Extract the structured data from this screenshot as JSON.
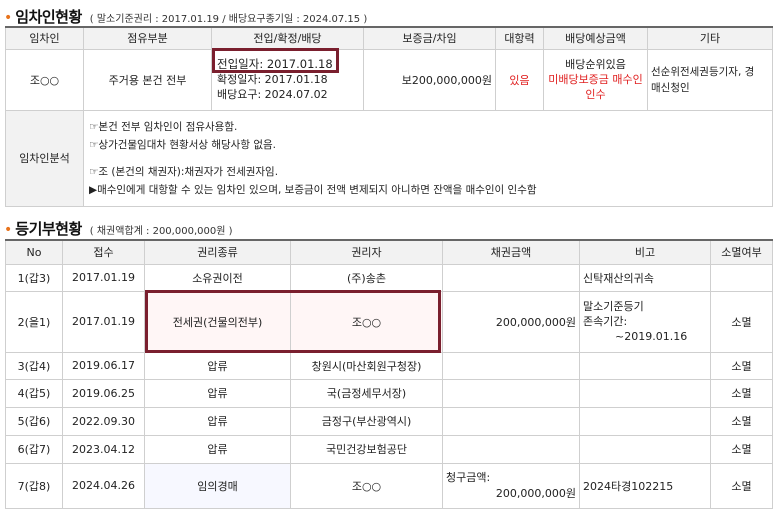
{
  "section1": {
    "title": "임차인현황",
    "subtitle": "( 말소기준권리 : 2017.01.19 / 배당요구종기일 : 2024.07.15 )",
    "headers": [
      "임차인",
      "점유부분",
      "전입/확정/배당",
      "보증금/차임",
      "대항력",
      "배당예상금액",
      "기타"
    ],
    "tenant": {
      "name": "조○○",
      "occupancy": "주거용 본건 전부",
      "move_in": "전입일자: 2017.01.18",
      "fixed_date": "확정일자: 2017.01.18",
      "dividend_date": "배당요구: 2024.07.02",
      "deposit": "보200,000,000원",
      "opposing_power": "있음",
      "dividend_line1": "배당순위있음",
      "dividend_line2": "미배당보증금 매수인",
      "dividend_line3": "인수",
      "etc_line1": "선순위전세권등기자, 경",
      "etc_line2": "매신청인"
    },
    "analysis": {
      "label": "임차인분석",
      "lines": [
        "☞본건 전부 임차인이 점유사용함.",
        "☞상가건물임대차 현황서상 해당사항 없음.",
        "",
        "☞조      (본건의 채권자):채권자가 전세권자임.",
        "▶매수인에게 대항할 수 있는 임차인 있으며, 보증금이 전액 변제되지 아니하면 잔액을 매수인이 인수함"
      ]
    }
  },
  "section2": {
    "title": "등기부현황",
    "subtitle": "( 채권액합계 : 200,000,000원 )",
    "headers": [
      "No",
      "접수",
      "권리종류",
      "권리자",
      "채권금액",
      "비고",
      "소멸여부"
    ],
    "rows": [
      {
        "no": "1(갑3)",
        "date": "2017.01.19",
        "type": "소유권이전",
        "holder": "(주)송촌",
        "amount": "",
        "note1": "신탁재산의귀속",
        "note2": "",
        "note3": "",
        "status": ""
      },
      {
        "no": "2(을1)",
        "date": "2017.01.19",
        "type": "전세권(건물의전부)",
        "holder": "조○○",
        "amount": "200,000,000원",
        "note1": "말소기준등기",
        "note2": "존속기간:",
        "note3": "~2019.01.16",
        "status": "소멸"
      },
      {
        "no": "3(갑4)",
        "date": "2019.06.17",
        "type": "압류",
        "holder": "창원시(마산회원구청장)",
        "amount": "",
        "note1": "",
        "note2": "",
        "note3": "",
        "status": "소멸"
      },
      {
        "no": "4(갑5)",
        "date": "2019.06.25",
        "type": "압류",
        "holder": "국(금정세무서장)",
        "amount": "",
        "note1": "",
        "note2": "",
        "note3": "",
        "status": "소멸"
      },
      {
        "no": "5(갑6)",
        "date": "2022.09.30",
        "type": "압류",
        "holder": "금정구(부산광역시)",
        "amount": "",
        "note1": "",
        "note2": "",
        "note3": "",
        "status": "소멸"
      },
      {
        "no": "6(갑7)",
        "date": "2023.04.12",
        "type": "압류",
        "holder": "국민건강보험공단",
        "amount": "",
        "note1": "",
        "note2": "",
        "note3": "",
        "status": "소멸"
      },
      {
        "no": "7(갑8)",
        "date": "2024.04.26",
        "type": "임의경매",
        "holder": "조○○",
        "amount_label": "청구금액:",
        "amount": "200,000,000원",
        "note1": "2024타경102215",
        "note2": "",
        "note3": "",
        "status": "소멸"
      }
    ]
  },
  "colors": {
    "accent_dot": "#e8731c",
    "highlight_border": "#7a1f2e",
    "red_text": "#e02020"
  }
}
